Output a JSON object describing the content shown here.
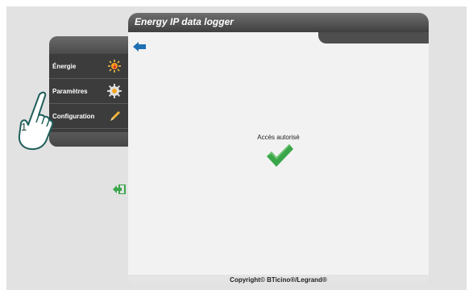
{
  "app": {
    "title": "Energy IP data logger"
  },
  "menu": {
    "items": [
      {
        "label": "Énergie",
        "icon": "energy-icon"
      },
      {
        "label": "Paramètres",
        "icon": "gear-icon"
      },
      {
        "label": "Configuration",
        "icon": "pencil-icon"
      }
    ]
  },
  "content": {
    "status": "Accès autorisé"
  },
  "footer": {
    "copyright": "Copyright© BTicino®/Legrand®"
  },
  "callout": {
    "number": "1"
  },
  "colors": {
    "check": "#3aa64a",
    "back_arrow": "#1f6fb3",
    "logout": "#3aa64a"
  }
}
